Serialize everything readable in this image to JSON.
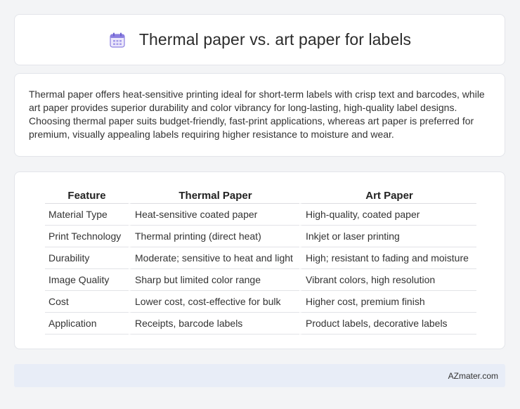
{
  "header": {
    "title": "Thermal paper vs. art paper for labels",
    "icon": "calendar-icon",
    "icon_color": "#7b6fd6"
  },
  "intro": {
    "text": "Thermal paper offers heat-sensitive printing ideal for short-term labels with crisp text and barcodes, while art paper provides superior durability and color vibrancy for long-lasting, high-quality label designs. Choosing thermal paper suits budget-friendly, fast-print applications, whereas art paper is preferred for premium, visually appealing labels requiring higher resistance to moisture and wear."
  },
  "comparison": {
    "headers": [
      "Feature",
      "Thermal Paper",
      "Art Paper"
    ],
    "rows": [
      [
        "Material Type",
        "Heat-sensitive coated paper",
        "High-quality, coated paper"
      ],
      [
        "Print Technology",
        "Thermal printing (direct heat)",
        "Inkjet or laser printing"
      ],
      [
        "Durability",
        "Moderate; sensitive to heat and light",
        "High; resistant to fading and moisture"
      ],
      [
        "Image Quality",
        "Sharp but limited color range",
        "Vibrant colors, high resolution"
      ],
      [
        "Cost",
        "Lower cost, cost-effective for bulk",
        "Higher cost, premium finish"
      ],
      [
        "Application",
        "Receipts, barcode labels",
        "Product labels, decorative labels"
      ]
    ]
  },
  "footer": {
    "brand": "AZmater.com"
  }
}
